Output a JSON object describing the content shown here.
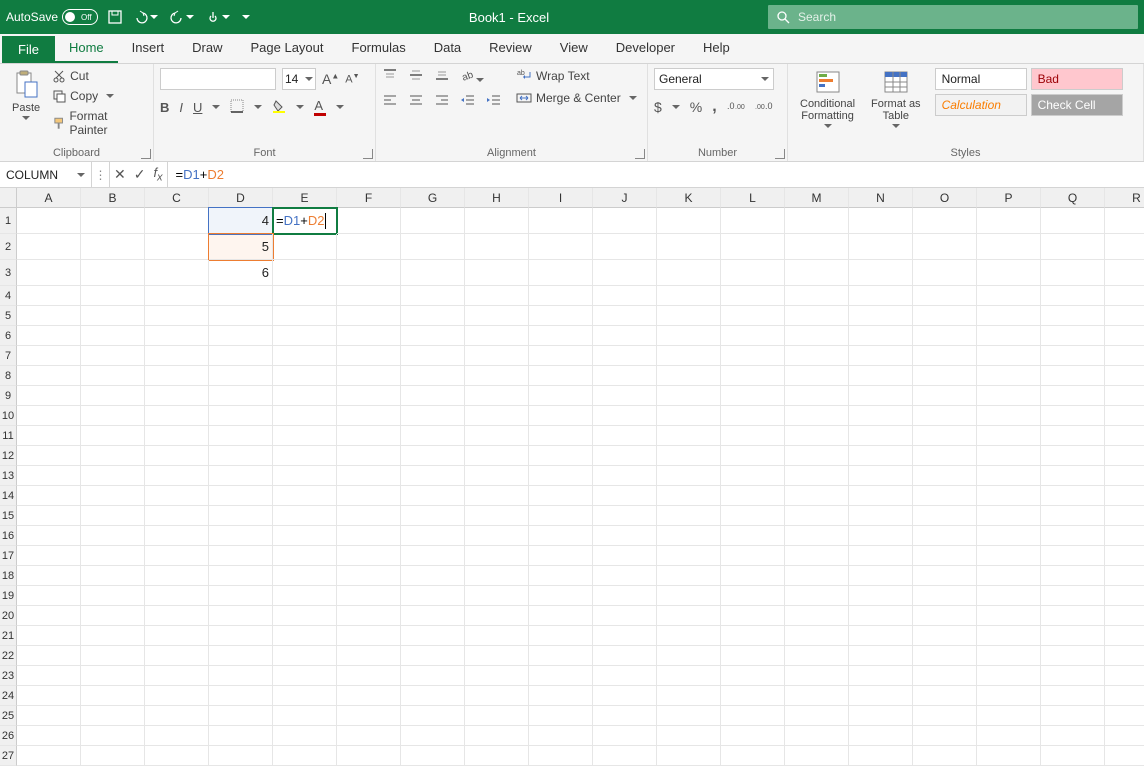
{
  "titlebar": {
    "autosave_label": "AutoSave",
    "autosave_state": "Off",
    "title": "Book1  -  Excel",
    "search_placeholder": "Search"
  },
  "tabs": {
    "file": "File",
    "items": [
      "Home",
      "Insert",
      "Draw",
      "Page Layout",
      "Formulas",
      "Data",
      "Review",
      "View",
      "Developer",
      "Help"
    ],
    "active": "Home"
  },
  "ribbon": {
    "clipboard": {
      "label": "Clipboard",
      "paste": "Paste",
      "cut": "Cut",
      "copy": "Copy",
      "format_painter": "Format Painter"
    },
    "font": {
      "label": "Font",
      "size": "14"
    },
    "alignment": {
      "label": "Alignment",
      "wrap": "Wrap Text",
      "merge": "Merge & Center"
    },
    "number": {
      "label": "Number",
      "format": "General"
    },
    "styles": {
      "label": "Styles",
      "conditional": "Conditional\nFormatting",
      "format_table": "Format as\nTable",
      "normal": "Normal",
      "bad": "Bad",
      "calculation": "Calculation",
      "check_cell": "Check Cell"
    }
  },
  "formula_bar": {
    "name_box": "COLUMN",
    "formula": "= D1 + D2"
  },
  "sheet": {
    "columns": [
      "A",
      "B",
      "C",
      "D",
      "E",
      "F",
      "G",
      "H",
      "I",
      "J",
      "K",
      "L",
      "M",
      "N",
      "O",
      "P",
      "Q",
      "R"
    ],
    "row_count": 27,
    "tall_rows": [
      1,
      2,
      3
    ],
    "cells": {
      "D1": "4",
      "D2": "5",
      "D3": "6",
      "E1_formula": {
        "eq": "= ",
        "r1": "D1",
        "plus": " + ",
        "r2": "D2"
      }
    },
    "active_cell": "E1",
    "ref_blue": "D1",
    "ref_orange": "D2"
  }
}
